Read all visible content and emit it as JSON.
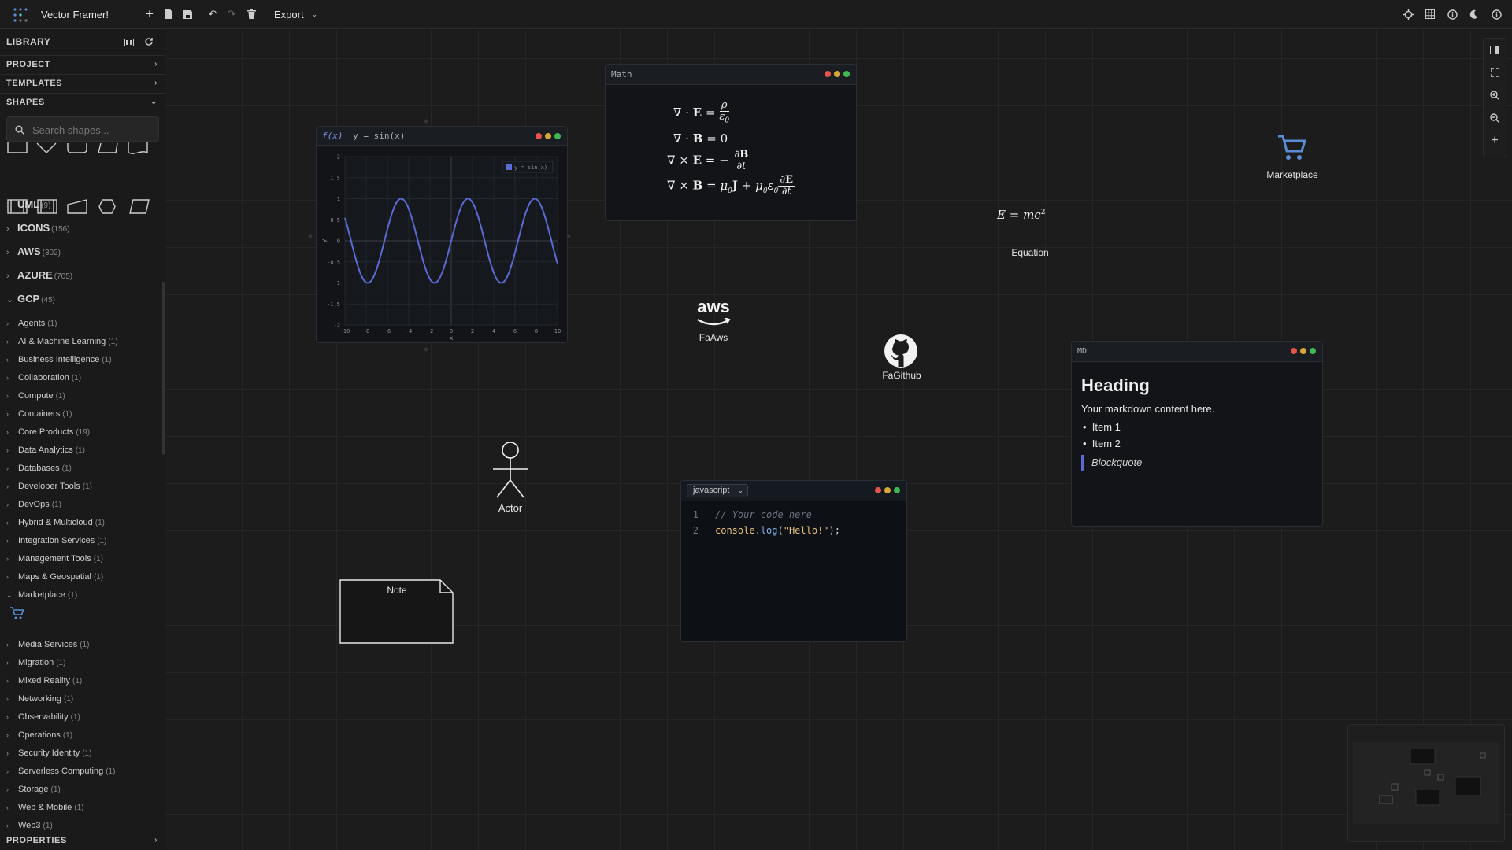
{
  "app": {
    "title": "Vector Framer!"
  },
  "toolbar": {
    "export_label": "Export"
  },
  "sidebar": {
    "library_title": "LIBRARY",
    "sections": {
      "project": "PROJECT",
      "templates": "TEMPLATES",
      "shapes": "SHAPES",
      "properties": "PROPERTIES"
    },
    "search_placeholder": "Search shapes...",
    "categories": [
      {
        "name": "UML",
        "count": "(9)"
      },
      {
        "name": "ICONS",
        "count": "(156)"
      },
      {
        "name": "AWS",
        "count": "(302)"
      },
      {
        "name": "AZURE",
        "count": "(705)"
      },
      {
        "name": "GCP",
        "count": "(45)"
      }
    ],
    "gcp_items": [
      {
        "name": "Agents",
        "count": "(1)"
      },
      {
        "name": "AI & Machine Learning",
        "count": "(1)"
      },
      {
        "name": "Business Intelligence",
        "count": "(1)"
      },
      {
        "name": "Collaboration",
        "count": "(1)"
      },
      {
        "name": "Compute",
        "count": "(1)"
      },
      {
        "name": "Containers",
        "count": "(1)"
      },
      {
        "name": "Core Products",
        "count": "(19)"
      },
      {
        "name": "Data Analytics",
        "count": "(1)"
      },
      {
        "name": "Databases",
        "count": "(1)"
      },
      {
        "name": "Developer Tools",
        "count": "(1)"
      },
      {
        "name": "DevOps",
        "count": "(1)"
      },
      {
        "name": "Hybrid & Multicloud",
        "count": "(1)"
      },
      {
        "name": "Integration Services",
        "count": "(1)"
      },
      {
        "name": "Management Tools",
        "count": "(1)"
      },
      {
        "name": "Maps & Geospatial",
        "count": "(1)"
      },
      {
        "name": "Marketplace",
        "count": "(1)"
      },
      {
        "name": "Media Services",
        "count": "(1)"
      },
      {
        "name": "Migration",
        "count": "(1)"
      },
      {
        "name": "Mixed Reality",
        "count": "(1)"
      },
      {
        "name": "Networking",
        "count": "(1)"
      },
      {
        "name": "Observability",
        "count": "(1)"
      },
      {
        "name": "Operations",
        "count": "(1)"
      },
      {
        "name": "Security Identity",
        "count": "(1)"
      },
      {
        "name": "Serverless Computing",
        "count": "(1)"
      },
      {
        "name": "Storage",
        "count": "(1)"
      },
      {
        "name": "Web & Mobile",
        "count": "(1)"
      },
      {
        "name": "Web3",
        "count": "(1)"
      }
    ]
  },
  "canvas": {
    "plot": {
      "title_fx": "f(x)",
      "title_expr": "y = sin(x)",
      "legend": "y = sin(x)",
      "xlabel": "x",
      "ylabel": "y"
    },
    "math": {
      "title": "Math"
    },
    "equation": {
      "label": "Equation"
    },
    "aws": {
      "logo": "aws",
      "label": "FaAws"
    },
    "github": {
      "label": "FaGithub"
    },
    "marketplace": {
      "label": "Marketplace"
    },
    "markdown": {
      "tag": "MD",
      "heading": "Heading",
      "body": "Your markdown content here.",
      "items": [
        "Item 1",
        "Item 2"
      ],
      "quote": "Blockquote"
    },
    "actor": {
      "label": "Actor"
    },
    "code": {
      "language": "javascript",
      "line_numbers": [
        "1",
        "2"
      ],
      "comment": "// Your code here",
      "code_obj": "console",
      "code_dot": ".",
      "code_fn": "log",
      "code_paren_open": "(",
      "code_str": "\"Hello!\"",
      "code_paren_close": ");"
    },
    "note": {
      "label": "Note"
    }
  },
  "colors": {
    "accent": "#5b6bd6",
    "dot_red": "#e5534b",
    "dot_yellow": "#d8a73a",
    "dot_green": "#3fb950"
  },
  "chart_data": {
    "type": "line",
    "title": "",
    "series": [
      {
        "name": "y = sin(x)",
        "function": "sin(x)"
      }
    ],
    "x_ticks": [
      "-10",
      "-8",
      "-6",
      "-4",
      "-2",
      "0",
      "2",
      "4",
      "6",
      "8",
      "10"
    ],
    "y_ticks": [
      "2",
      "1.5",
      "1",
      "0.5",
      "0",
      "-0.5",
      "-1",
      "-1.5",
      "-2"
    ],
    "xlim": [
      -10,
      10
    ],
    "ylim": [
      -2,
      2
    ],
    "xlabel": "x",
    "ylabel": "y",
    "grid": true,
    "legend": "top-right"
  }
}
